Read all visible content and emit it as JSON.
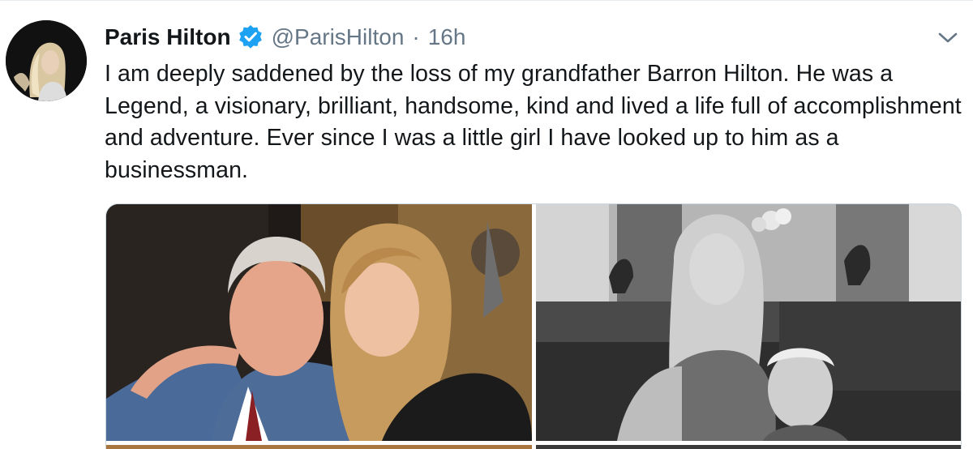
{
  "tweet": {
    "author": {
      "display_name": "Paris Hilton",
      "handle": "@ParisHilton",
      "verified": true,
      "avatar": "profile-photo"
    },
    "separator": "·",
    "time": "16h",
    "menu_icon": "chevron-down-icon",
    "text": "I am deeply saddened by the loss of my grandfather Barron Hilton. He was a Legend, a visionary, brilliant, handsome, kind and lived a life full of accomplishment and adventure. Ever since I was a little girl I have looked up to him as a businessman.",
    "media": [
      {
        "kind": "photo",
        "description": "color-photo-grandfather-and-granddaughter"
      },
      {
        "kind": "photo",
        "description": "black-and-white-photo-in-living-room"
      },
      {
        "kind": "photo",
        "description": "partially-visible-photo"
      },
      {
        "kind": "photo",
        "description": "partially-visible-photo"
      }
    ]
  },
  "colors": {
    "text_primary": "#14171a",
    "text_secondary": "#657786",
    "verified_blue": "#1da1f2",
    "border": "#ccd6dd"
  }
}
